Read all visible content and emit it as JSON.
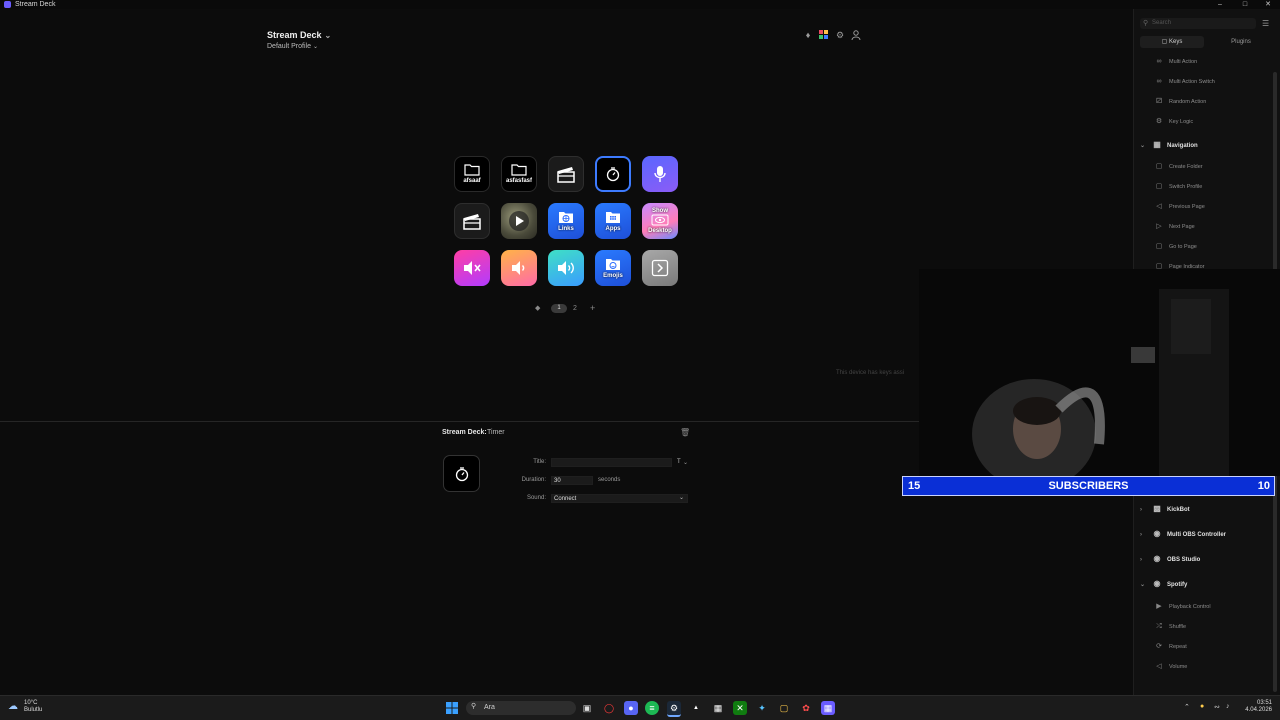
{
  "window": {
    "title": "Stream Deck"
  },
  "header": {
    "device": "Stream Deck",
    "profile": "Default Profile"
  },
  "keys": [
    {
      "label": "afsaaf"
    },
    {
      "label": "asfasfasf"
    },
    {
      "label": ""
    },
    {
      "label": ""
    },
    {
      "label": ""
    },
    {
      "label": ""
    },
    {
      "label": ""
    },
    {
      "label": "Links"
    },
    {
      "label": "Apps"
    },
    {
      "label_top": "Show",
      "label": "Desktop"
    },
    {
      "label": ""
    },
    {
      "label": ""
    },
    {
      "label": ""
    },
    {
      "label": "Emojis"
    },
    {
      "label": ""
    }
  ],
  "pager": {
    "page1": "1",
    "page2": "2",
    "add": "+",
    "prev": "◆"
  },
  "properties": {
    "title": "Stream Deck:",
    "action": "Timer",
    "title_label": "Title:",
    "title_value": "",
    "title_toggle": "T",
    "duration_label": "Duration:",
    "duration_value": "30",
    "duration_unit": "seconds",
    "sound_label": "Sound:",
    "sound_value": "Connect"
  },
  "right_panel": {
    "search_placeholder": "Search",
    "tabs": {
      "keys": "Keys",
      "plugins": "Plugins"
    },
    "items_top": [
      {
        "label": "Multi Action"
      },
      {
        "label": "Multi Action Switch"
      },
      {
        "label": "Random Action"
      },
      {
        "label": "Key Logic"
      }
    ],
    "navigation": {
      "label": "Navigation",
      "items": [
        {
          "label": "Create Folder"
        },
        {
          "label": "Switch Profile"
        },
        {
          "label": "Previous Page"
        },
        {
          "label": "Next Page"
        },
        {
          "label": "Go to Page"
        },
        {
          "label": "Page Indicator"
        }
      ]
    },
    "groups": [
      {
        "label": "KickBot"
      },
      {
        "label": "Multi OBS Controller"
      },
      {
        "label": "OBS Studio"
      }
    ],
    "spotify": {
      "label": "Spotify",
      "items": [
        {
          "label": "Playback Control"
        },
        {
          "label": "Shuffle"
        },
        {
          "label": "Repeat"
        },
        {
          "label": "Volume"
        }
      ]
    }
  },
  "center_message": "This device has keys assi",
  "overlay": {
    "left_count": "15",
    "caption": "SUBSCRIBERS",
    "right_count": "10"
  },
  "taskbar": {
    "search_label": "Ara",
    "weather_temp": "10°C",
    "weather_desc": "Bulutlu",
    "time": "03:51",
    "date": "4.04.2026"
  },
  "colors": {
    "accent": "#3d7bff",
    "overlay_bar": "#0a2fd6"
  }
}
